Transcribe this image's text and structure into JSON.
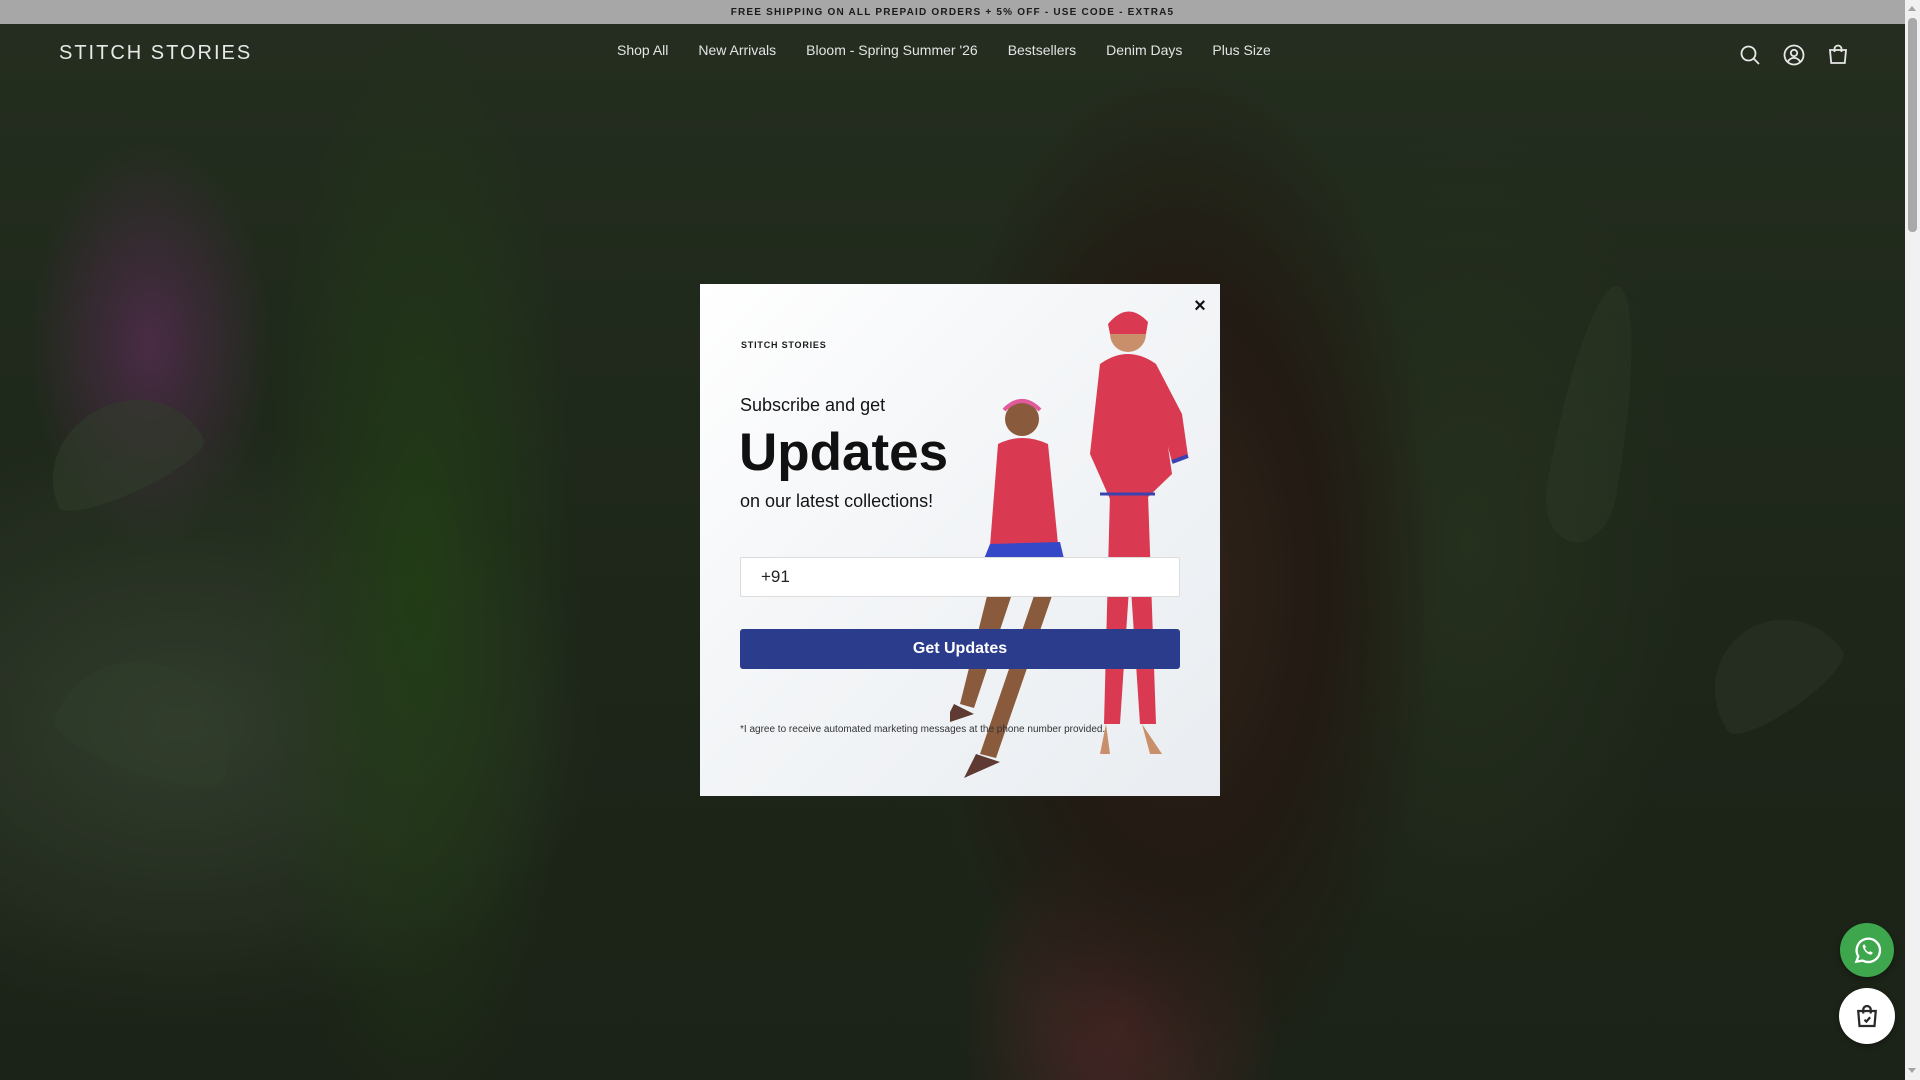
{
  "announcement": {
    "text": "FREE SHIPPING ON ALL PREPAID ORDERS + 5% OFF - USE CODE - EXTRA5"
  },
  "header": {
    "logo": "STITCH STORIES",
    "nav": [
      {
        "label": "Shop All"
      },
      {
        "label": "New Arrivals"
      },
      {
        "label": "Bloom - Spring Summer '26"
      },
      {
        "label": "Bestsellers"
      },
      {
        "label": "Denim Days"
      },
      {
        "label": "Plus Size"
      }
    ],
    "icons": [
      "search-icon",
      "account-icon",
      "cart-icon"
    ]
  },
  "popup": {
    "brand": "STITCH STORIES",
    "subtitle": "Subscribe and get",
    "title": "Updates",
    "line": "on our latest collections!",
    "phone_value": "+91",
    "cta_label": "Get Updates",
    "consent": "*I agree to receive automated marketing messages at the phone number provided.",
    "close_label": "×"
  },
  "colors": {
    "cta": "#2c3c8c",
    "whatsapp": "#3ea64d",
    "announcement_bg": "#a7a7a7",
    "product_red": "#d93a52"
  }
}
